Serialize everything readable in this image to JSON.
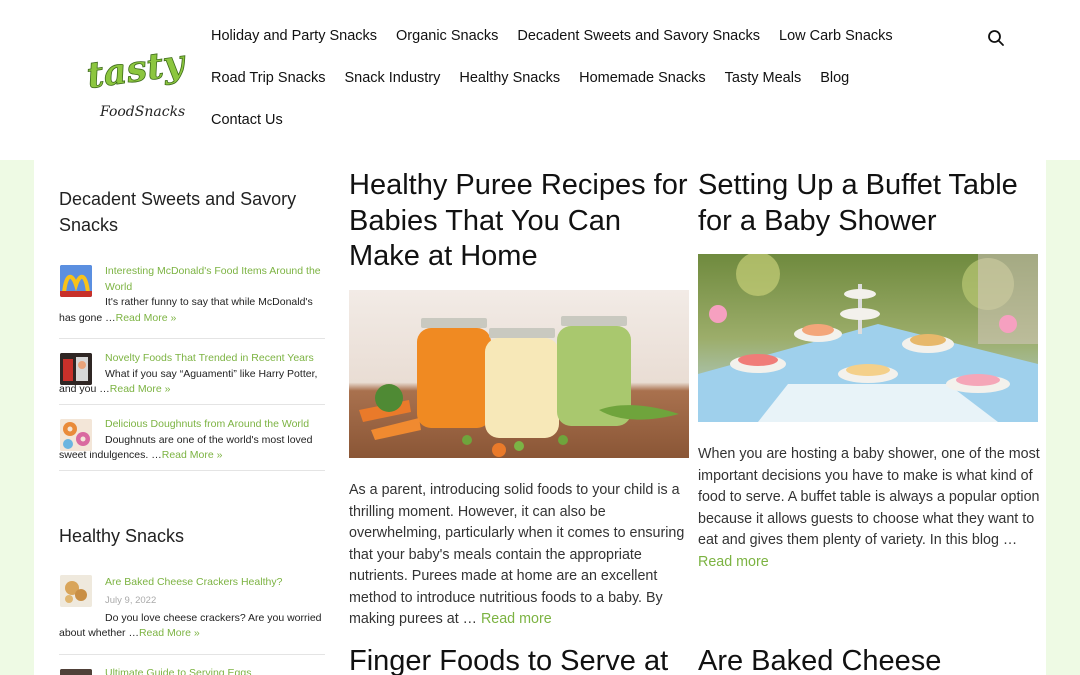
{
  "site": {
    "logo_text_top": "tasty",
    "logo_text_bottom": "FoodSnacks"
  },
  "nav": {
    "row1": [
      "Holiday and Party Snacks",
      "Organic Snacks",
      "Decadent Sweets and Savory Snacks",
      "Low Carb Snacks"
    ],
    "row2": [
      "Road Trip Snacks",
      "Snack Industry",
      "Healthy Snacks",
      "Homemade Snacks",
      "Tasty Meals",
      "Blog"
    ],
    "row3": [
      "Contact Us"
    ],
    "search_icon": "search-icon"
  },
  "sidebar": {
    "widget1": {
      "title": "Decadent Sweets and Savory Snacks",
      "items": [
        {
          "title": "Interesting McDonald's Food Items Around the World",
          "excerpt": "It's rather funny to say that while McDonald's has gone …",
          "more": "Read More »"
        },
        {
          "title": "Novelty Foods That Trended in Recent Years",
          "excerpt": "What if you say “Aguamenti” like Harry Potter, and you …",
          "more": "Read More »"
        },
        {
          "title": "Delicious Doughnuts from Around the World",
          "excerpt": "Doughnuts are one of the world's most loved sweet indulgences. …",
          "more": "Read More »"
        }
      ]
    },
    "widget2": {
      "title": "Healthy Snacks",
      "items": [
        {
          "title": "Are Baked Cheese Crackers Healthy?",
          "date": "July 9, 2022",
          "excerpt": "Do you love cheese crackers? Are you worried about whether …",
          "more": "Read More »"
        },
        {
          "title": "Ultimate Guide to Serving Eggs"
        }
      ]
    }
  },
  "posts": [
    {
      "title": "Healthy Puree Recipes for Babies That You Can Make at Home",
      "excerpt": "As a parent, introducing solid foods to your child is a thrilling moment. However, it can also be overwhelming, particularly when it comes to ensuring that your baby's meals contain the appropriate nutrients. Purees made at home are an excellent method to introduce nutritious foods to a baby. By making purees at …",
      "more": "Read more"
    },
    {
      "title": "Setting Up a Buffet Table for a Baby Shower",
      "excerpt": "When you are hosting a baby shower, one of the most important decisions you have to make is what kind of food to serve. A buffet table is always a popular option because it allows guests to choose what they want to eat and gives them plenty of variety. In this blog …",
      "more": "Read more"
    },
    {
      "title": "Finger Foods to Serve at"
    },
    {
      "title": "Are Baked Cheese"
    }
  ]
}
